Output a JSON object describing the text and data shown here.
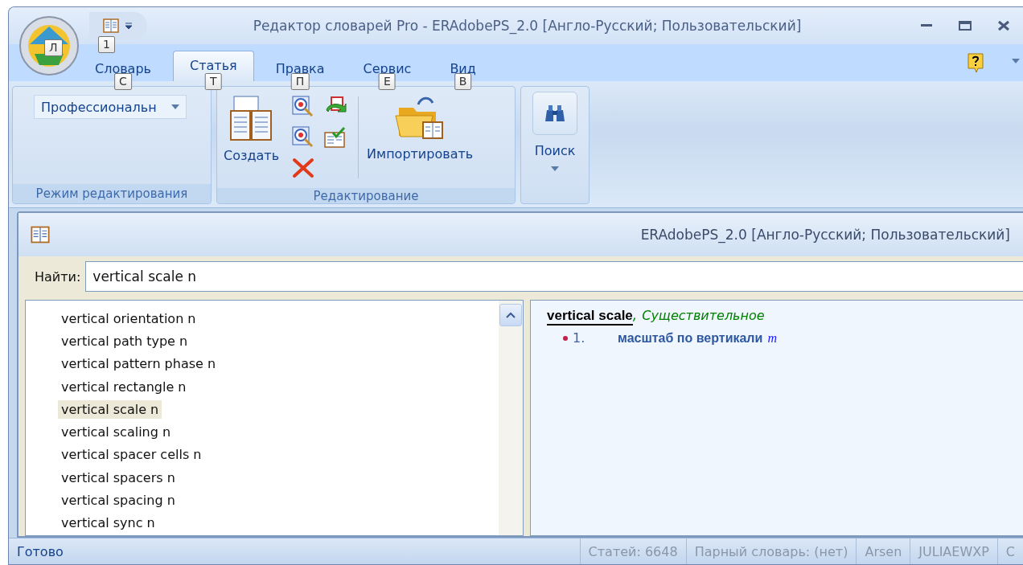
{
  "window": {
    "title": "Редактор словарей Pro - ERAdobePS_2.0 [Англо-Русский; Пользовательский]",
    "orb_keytip": "Л",
    "qat_keytip": "1"
  },
  "tabs": [
    {
      "label": "Словарь",
      "keytip": "С",
      "selected": false
    },
    {
      "label": "Статья",
      "keytip": "Т",
      "selected": true
    },
    {
      "label": "Правка",
      "keytip": "П",
      "selected": false
    },
    {
      "label": "Сервис",
      "keytip": "Е",
      "selected": false
    },
    {
      "label": "Вид",
      "keytip": "В",
      "selected": false
    }
  ],
  "ribbon": {
    "groups": [
      {
        "kind": "mode",
        "label": "Режим редактирования",
        "dropdown": "Профессиональн"
      },
      {
        "kind": "edit",
        "label": "Редактирование",
        "create": "Создать",
        "import": "Импортировать"
      },
      {
        "kind": "search",
        "button": "Поиск"
      }
    ]
  },
  "document": {
    "title": "ERAdobePS_2.0 [Англо-Русский; Пользовательский]",
    "find_label": "Найти:",
    "find_value": "vertical scale n",
    "entries": [
      {
        "text": "vertical orientation n",
        "selected": false
      },
      {
        "text": "vertical path type n",
        "selected": false
      },
      {
        "text": "vertical pattern phase n",
        "selected": false
      },
      {
        "text": "vertical rectangle n",
        "selected": false
      },
      {
        "text": "vertical scale n",
        "selected": true
      },
      {
        "text": "vertical scaling n",
        "selected": false
      },
      {
        "text": "vertical spacer cells n",
        "selected": false
      },
      {
        "text": "vertical spacers n",
        "selected": false
      },
      {
        "text": "vertical spacing n",
        "selected": false
      },
      {
        "text": "vertical sync n",
        "selected": false
      }
    ],
    "article": {
      "headword": "vertical scale",
      "separator": ",",
      "part_of_speech": "Существительное",
      "senses": [
        {
          "number": "1.",
          "translation": "масштаб по вертикали",
          "gender": "m"
        }
      ]
    }
  },
  "status_bar": [
    "Готово",
    "Статей: 6648",
    "Парный словарь:  (нет)",
    "Arsen",
    "JULIAEWXP",
    "C"
  ]
}
